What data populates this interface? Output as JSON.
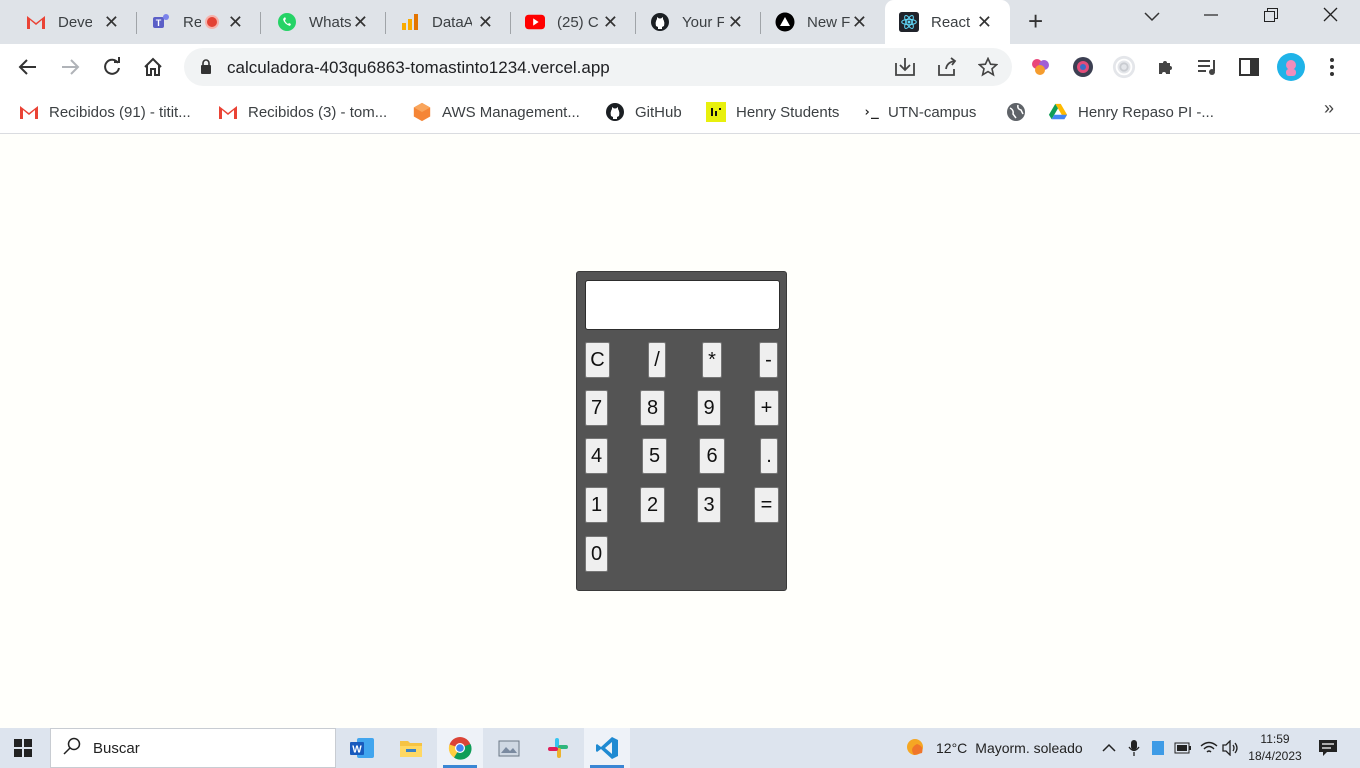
{
  "browser": {
    "tabs": [
      {
        "title": "Develo",
        "icon": "gmail-icon"
      },
      {
        "title": "Re",
        "icon": "teams-icon"
      },
      {
        "title": "Whats",
        "icon": "whatsapp-icon"
      },
      {
        "title": "DataAn",
        "icon": "analytics-icon"
      },
      {
        "title": "(25) C",
        "icon": "youtube-icon"
      },
      {
        "title": "Your F",
        "icon": "github-icon"
      },
      {
        "title": "New F",
        "icon": "vercel-icon"
      },
      {
        "title": "React",
        "icon": "react-icon",
        "active": true
      }
    ],
    "url": "calculadora-403qu6863-tomastinto1234.vercel.app",
    "bookmarks": [
      {
        "label": "Recibidos (91) - titit...",
        "icon": "gmail-icon"
      },
      {
        "label": "Recibidos (3) - tom...",
        "icon": "gmail-icon"
      },
      {
        "label": "AWS Management...",
        "icon": "aws-icon"
      },
      {
        "label": "GitHub",
        "icon": "github-icon"
      },
      {
        "label": "Henry Students",
        "icon": "henry-icon"
      },
      {
        "label": "UTN-campus",
        "icon": "terminal-icon"
      },
      {
        "label": "",
        "icon": "globe-icon"
      },
      {
        "label": "Henry Repaso PI -...",
        "icon": "drive-icon"
      }
    ],
    "bookmarks_more": "»"
  },
  "calculator": {
    "display_value": "",
    "keys": {
      "clear": "C",
      "divide": "/",
      "multiply": "*",
      "minus": "-",
      "seven": "7",
      "eight": "8",
      "nine": "9",
      "plus": "+",
      "four": "4",
      "five": "5",
      "six": "6",
      "dot": ".",
      "one": "1",
      "two": "2",
      "three": "3",
      "equals": "=",
      "zero": "0"
    }
  },
  "taskbar": {
    "search_placeholder": "Buscar",
    "weather": {
      "temp": "12°C",
      "desc": "Mayorm. soleado"
    },
    "time": "11:59",
    "date": "18/4/2023"
  }
}
